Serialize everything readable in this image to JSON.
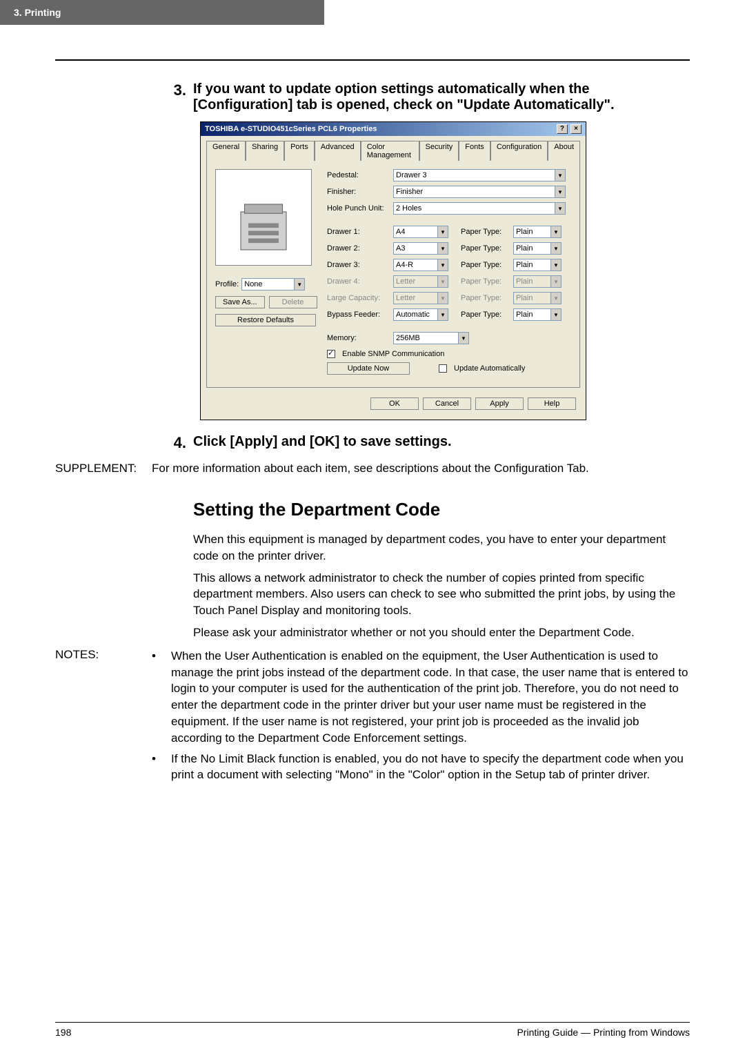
{
  "header": {
    "chapter": "3.  Printing"
  },
  "steps": {
    "s3": {
      "num": "3.",
      "text": "If you want to update option settings automatically when the [Configuration] tab is opened, check on \"Update Automatically\"."
    },
    "s4": {
      "num": "4.",
      "text": "Click [Apply] and [OK] to save settings."
    }
  },
  "dialog": {
    "title": "TOSHIBA e-STUDIO451cSeries PCL6 Properties",
    "help_btn": "?",
    "close_btn": "×",
    "tabs": [
      "General",
      "Sharing",
      "Ports",
      "Advanced",
      "Color Management",
      "Security",
      "Fonts",
      "Configuration",
      "About"
    ],
    "active_tab_index": 7,
    "pedestal_label": "Pedestal:",
    "pedestal_value": "Drawer 3",
    "finisher_label": "Finisher:",
    "finisher_value": "Finisher",
    "holepunch_label": "Hole Punch Unit:",
    "holepunch_value": "2 Holes",
    "papertype_label": "Paper Type:",
    "drawers": [
      {
        "label": "Drawer 1:",
        "size": "A4",
        "type": "Plain",
        "enabled": true
      },
      {
        "label": "Drawer 2:",
        "size": "A3",
        "type": "Plain",
        "enabled": true
      },
      {
        "label": "Drawer 3:",
        "size": "A4-R",
        "type": "Plain",
        "enabled": true
      },
      {
        "label": "Drawer 4:",
        "size": "Letter",
        "type": "Plain",
        "enabled": false
      },
      {
        "label": "Large Capacity:",
        "size": "Letter",
        "type": "Plain",
        "enabled": false
      },
      {
        "label": "Bypass Feeder:",
        "size": "Automatic",
        "type": "Plain",
        "enabled": true
      }
    ],
    "memory_label": "Memory:",
    "memory_value": "256MB",
    "profile_label": "Profile:",
    "profile_value": "None",
    "saveas_btn": "Save As...",
    "delete_btn": "Delete",
    "restore_btn": "Restore Defaults",
    "snmp_label": "Enable SNMP Communication",
    "updatenow_btn": "Update Now",
    "updateauto_label": "Update Automatically",
    "ok_btn": "OK",
    "cancel_btn": "Cancel",
    "apply_btn": "Apply",
    "helpb_btn": "Help"
  },
  "supplement": {
    "label": "SUPPLEMENT:",
    "text": "For more information about each item, see descriptions about the Configuration Tab."
  },
  "section_title": "Setting the Department Code",
  "para1": "When this equipment is managed by department codes, you have to enter your department code on the printer driver.",
  "para2": "This allows a network administrator to check the number of copies printed from specific department members.  Also users can check to see who submitted the print jobs, by using the Touch Panel Display and monitoring tools.",
  "para3": "Please ask your administrator whether or not you should enter the Department Code.",
  "notes": {
    "label": "NOTES:",
    "items": [
      "When the User Authentication is enabled on the equipment, the User Authentication is used to manage the print jobs instead of the department code.  In that case, the user name that is entered to login to your computer is used for the authentication of the print job. Therefore, you do not need to enter the department code in the printer driver but your user name must be registered in the equipment. If the user name is not registered, your print job is proceeded as the invalid job according to the Department Code Enforcement settings.",
      "If the No Limit Black function is enabled, you do not have to specify the department code when you print a document with selecting \"Mono\" in the \"Color\" option in the Setup tab of printer driver."
    ]
  },
  "footer": {
    "page": "198",
    "right": "Printing Guide — Printing from Windows"
  }
}
